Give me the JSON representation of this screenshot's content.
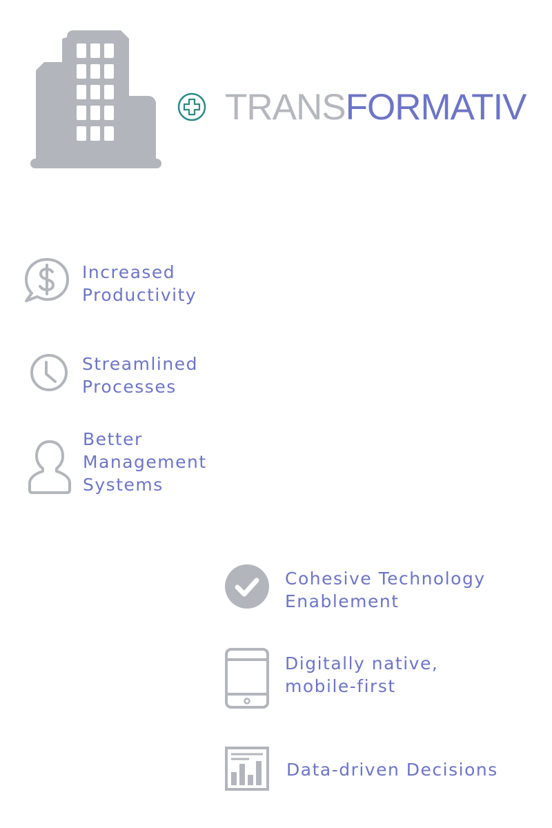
{
  "brand": {
    "prefix": "TRANS",
    "suffix": "FORMATIV"
  },
  "colors": {
    "accent": "#6c75c6",
    "icon_gray": "#b3b5bc",
    "brand_gray": "#b5b7be",
    "plus_teal": "#2a8a86"
  },
  "left_features": [
    {
      "icon": "dollar-chat-icon",
      "lines": [
        "Increased",
        "Productivity"
      ]
    },
    {
      "icon": "clock-icon",
      "lines": [
        "Streamlined",
        "Processes"
      ]
    },
    {
      "icon": "user-icon",
      "lines": [
        "Better",
        "Management",
        "Systems"
      ]
    }
  ],
  "right_features": [
    {
      "icon": "check-circle-icon",
      "lines": [
        "Cohesive Technology",
        "Enablement"
      ]
    },
    {
      "icon": "tablet-icon",
      "lines": [
        "Digitally native,",
        "mobile-first"
      ]
    },
    {
      "icon": "bar-chart-icon",
      "lines": [
        "Data-driven Decisions"
      ]
    }
  ]
}
